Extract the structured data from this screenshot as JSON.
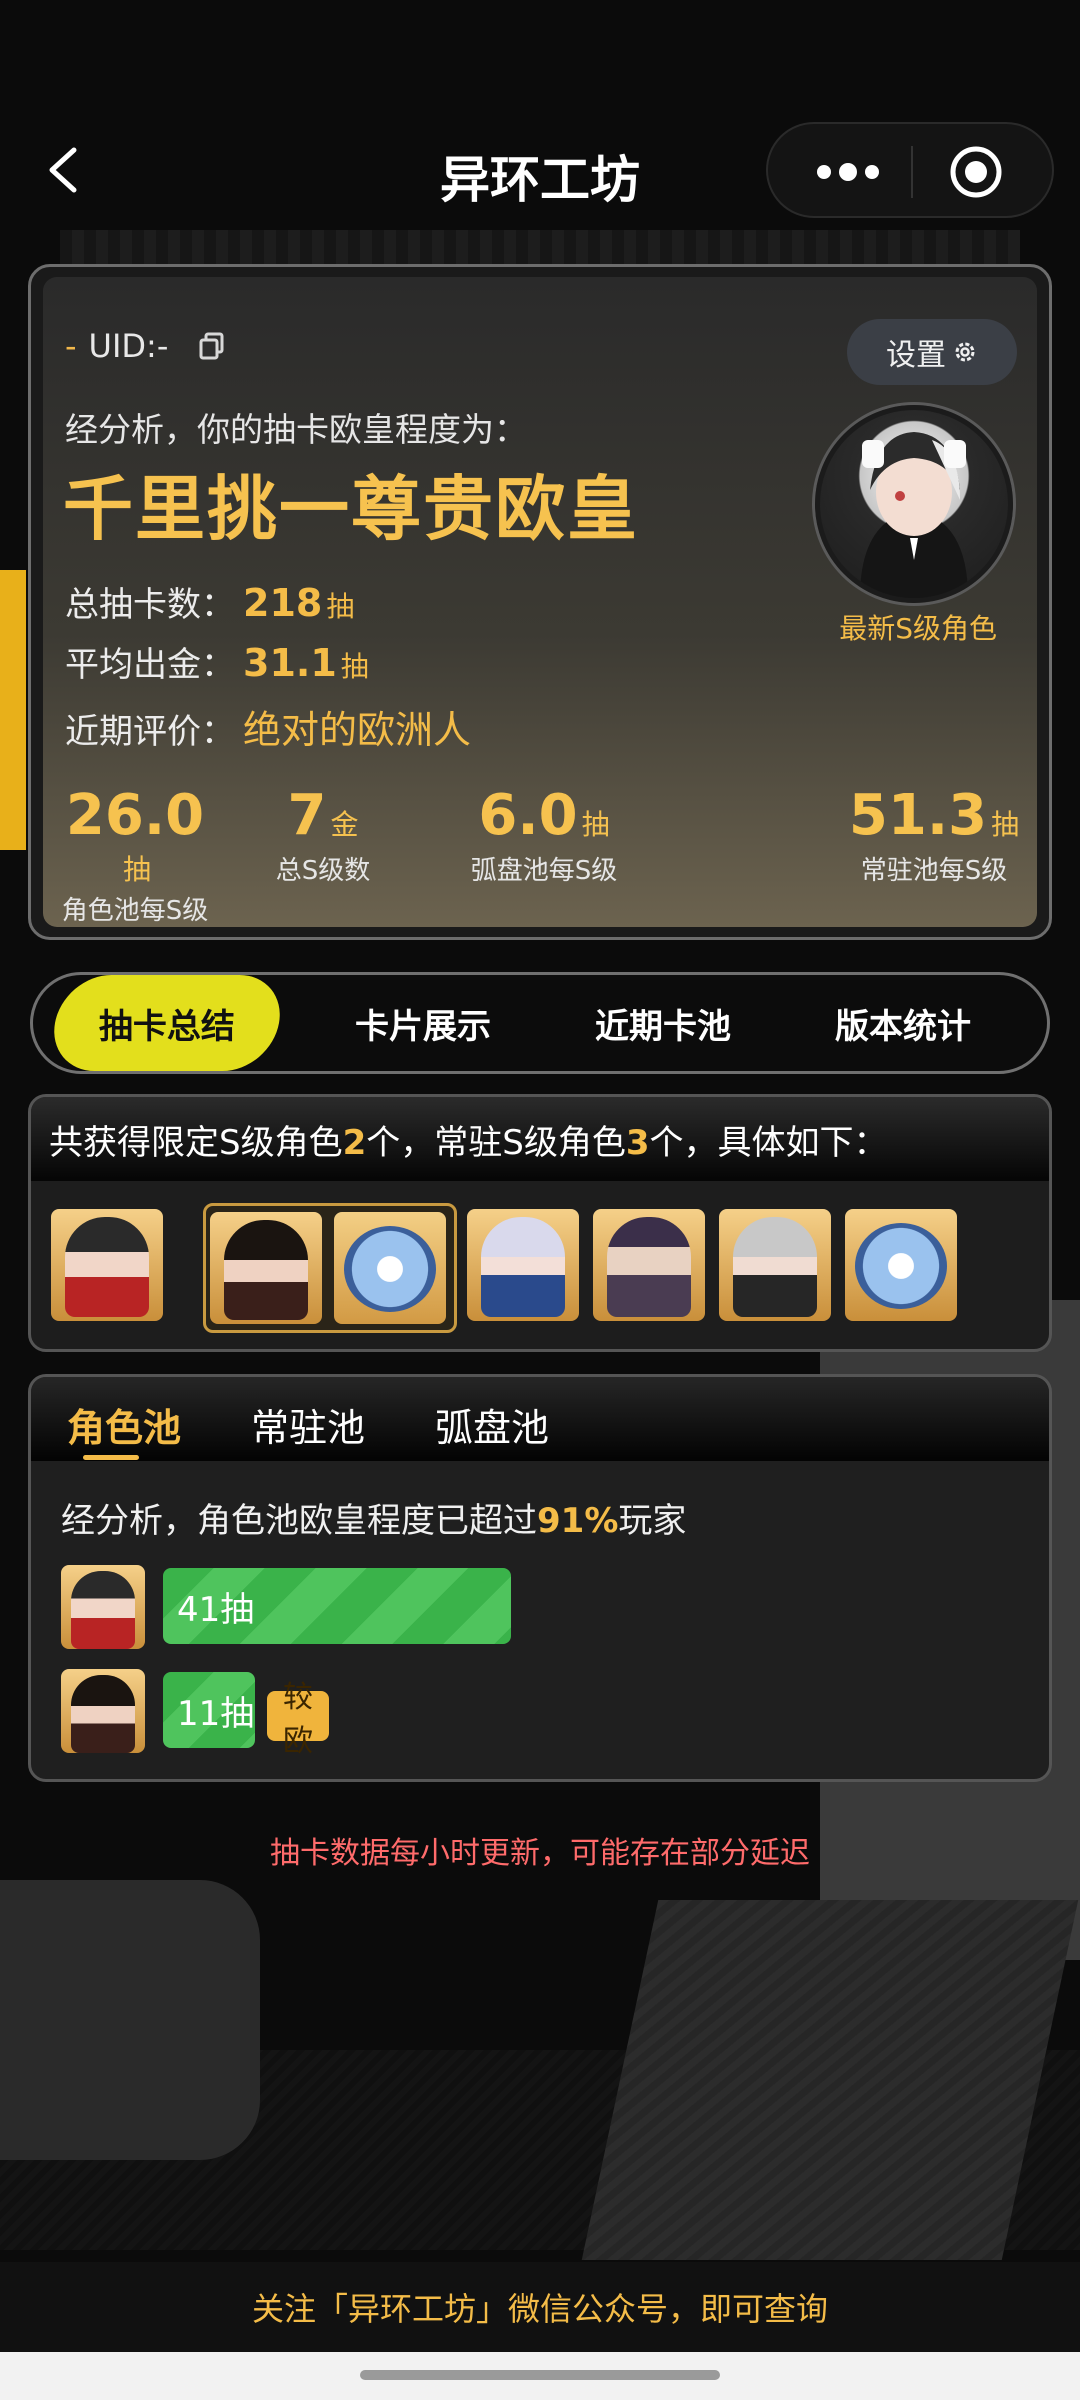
{
  "header": {
    "title": "异环工坊"
  },
  "profile": {
    "uid_prefix": "-",
    "uid_label": "UID:-",
    "settings_label": "设置",
    "analysis_text": "经分析，你的抽卡欧皇程度为：",
    "rank_title": "千里挑一尊贵欧皇",
    "total_label": "总抽卡数：",
    "total_value": "218",
    "total_unit": "抽",
    "avg_label": "平均出金：",
    "avg_value": "31.1",
    "avg_unit": "抽",
    "recent_label": "近期评价：",
    "recent_value": "绝对的欧洲人",
    "avatar_caption": "最新S级角色",
    "metrics": [
      {
        "value": "26.0",
        "unit": "抽",
        "label": "角色池每S级"
      },
      {
        "value": "7",
        "unit": "金",
        "label": "总S级数"
      },
      {
        "value": "6.0",
        "unit": "抽",
        "label": "弧盘池每S级"
      },
      {
        "value": "51.3",
        "unit": "抽",
        "label": "常驻池每S级"
      }
    ]
  },
  "tabs": [
    "抽卡总结",
    "卡片展示",
    "近期卡池",
    "版本统计"
  ],
  "summary": {
    "text_1": "共获得限定S级角色",
    "limited_count": "2",
    "text_2": "个，常驻S级角色",
    "standard_count": "3",
    "text_3": "个，具体如下："
  },
  "pool": {
    "tabs": [
      "角色池",
      "常驻池",
      "弧盘池"
    ],
    "analysis_1": "经分析，角色池欧皇程度已超过",
    "percent": "91%",
    "analysis_2": "玩家",
    "pulls": [
      {
        "label": "41抽",
        "badge": ""
      },
      {
        "label": "11抽",
        "badge": "较欧"
      }
    ]
  },
  "notice": "抽卡数据每小时更新，可能存在部分延迟",
  "footer": "关注「异环工坊」微信公众号，即可查询",
  "colors": {
    "accent": "#f4bc48",
    "tab_active": "#e3df1c",
    "bar_green": "#3ab34a",
    "notice_red": "#ff6b6b"
  }
}
